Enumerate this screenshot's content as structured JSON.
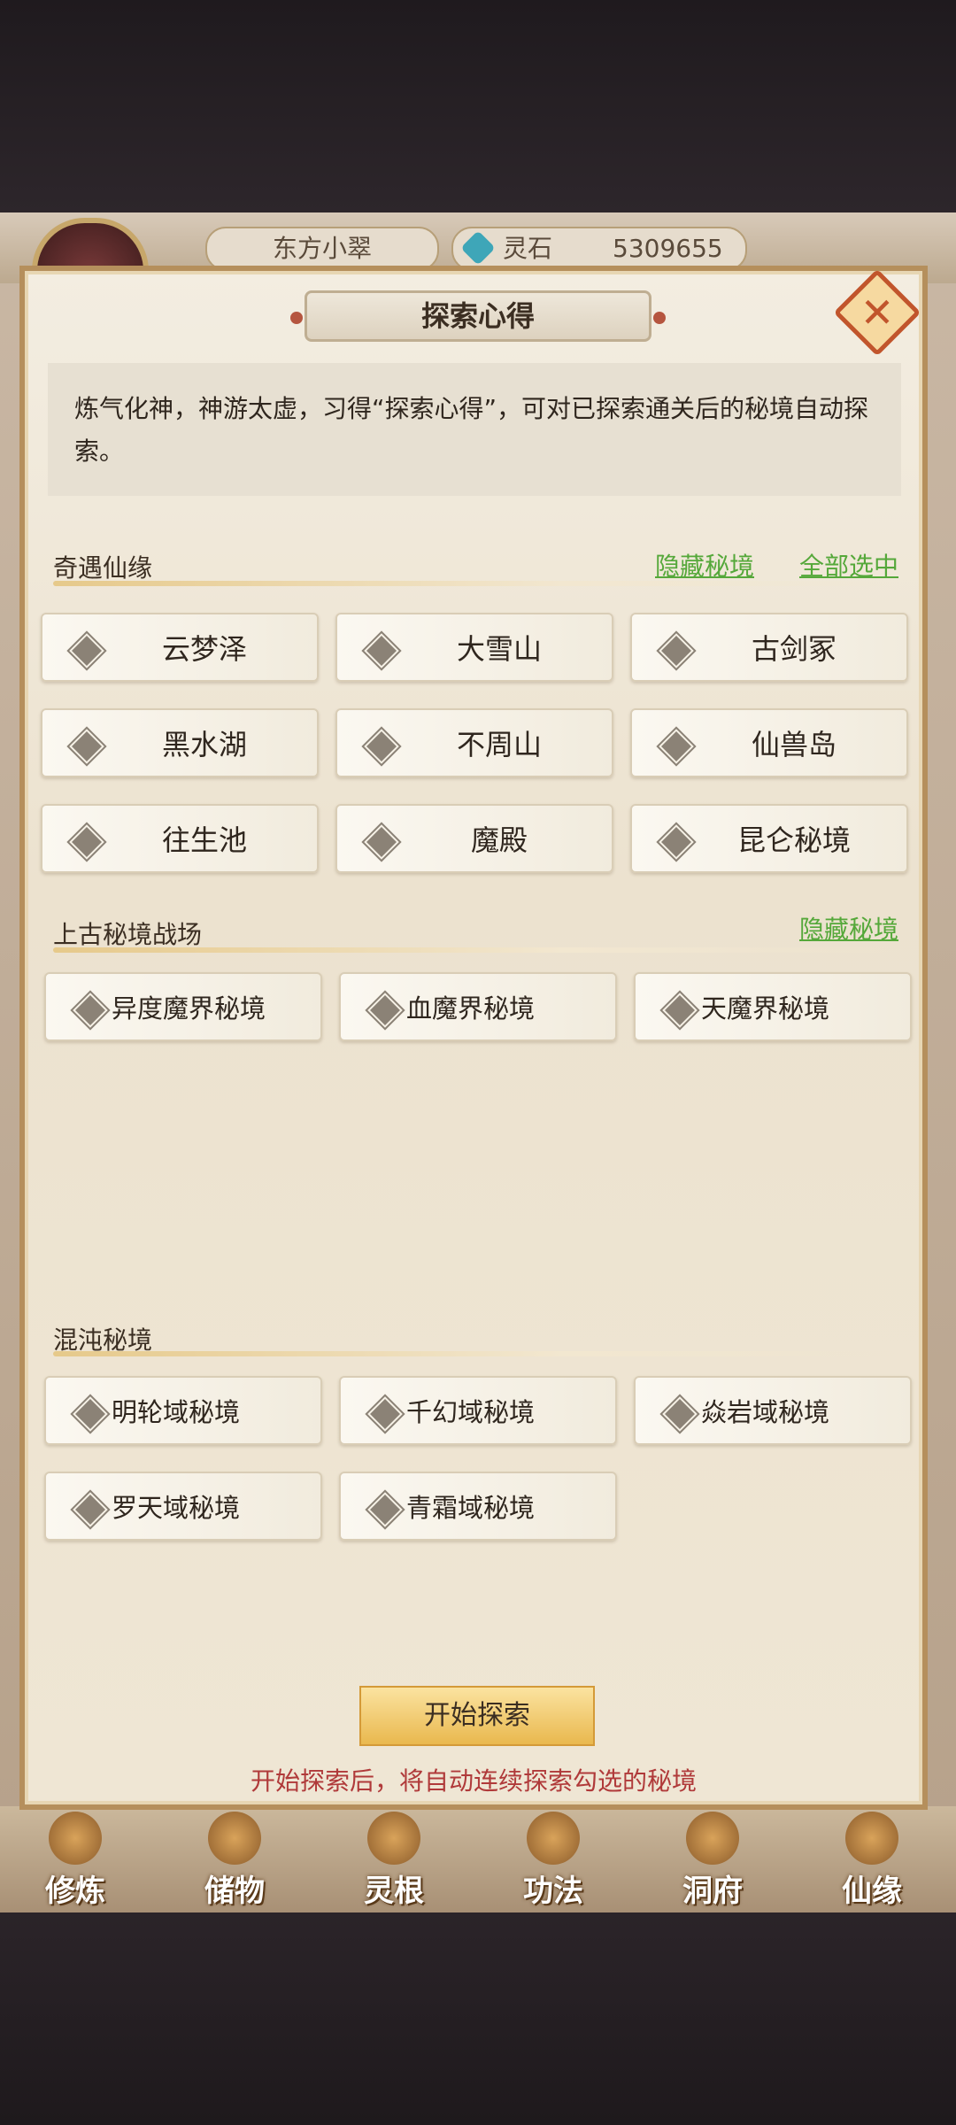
{
  "hud": {
    "player_name": "东方小翠",
    "currency_label": "灵石",
    "currency_value": "5309655"
  },
  "dialog": {
    "title": "探索心得",
    "close_label": "✕",
    "description": "炼气化神，神游太虚，习得“探索心得”，可对已探索通关后的秘境自动探索。"
  },
  "sections": {
    "qiyu": {
      "title": "奇遇仙缘",
      "hide_link": "隐藏秘境",
      "select_all_link": "全部选中",
      "items": [
        "云梦泽",
        "大雪山",
        "古剑冢",
        "黑水湖",
        "不周山",
        "仙兽岛",
        "往生池",
        "魔殿",
        "昆仑秘境"
      ]
    },
    "shanggu": {
      "title": "上古秘境战场",
      "hide_link": "隐藏秘境",
      "items": [
        "异度魔界秘境",
        "血魔界秘境",
        "天魔界秘境"
      ]
    },
    "hundun": {
      "title": "混沌秘境",
      "items": [
        "明轮域秘境",
        "千幻域秘境",
        "焱岩域秘境",
        "罗天域秘境",
        "青霜域秘境"
      ]
    }
  },
  "actions": {
    "start_label": "开始探索",
    "hint": "开始探索后，将自动连续探索勾选的秘境"
  },
  "bottom_nav": [
    "修炼",
    "储物",
    "灵根",
    "功法",
    "洞府",
    "仙缘"
  ],
  "colors": {
    "link_green": "#55a83a",
    "hint_red": "#b03a3a",
    "frame_gold": "#b58f5c"
  }
}
